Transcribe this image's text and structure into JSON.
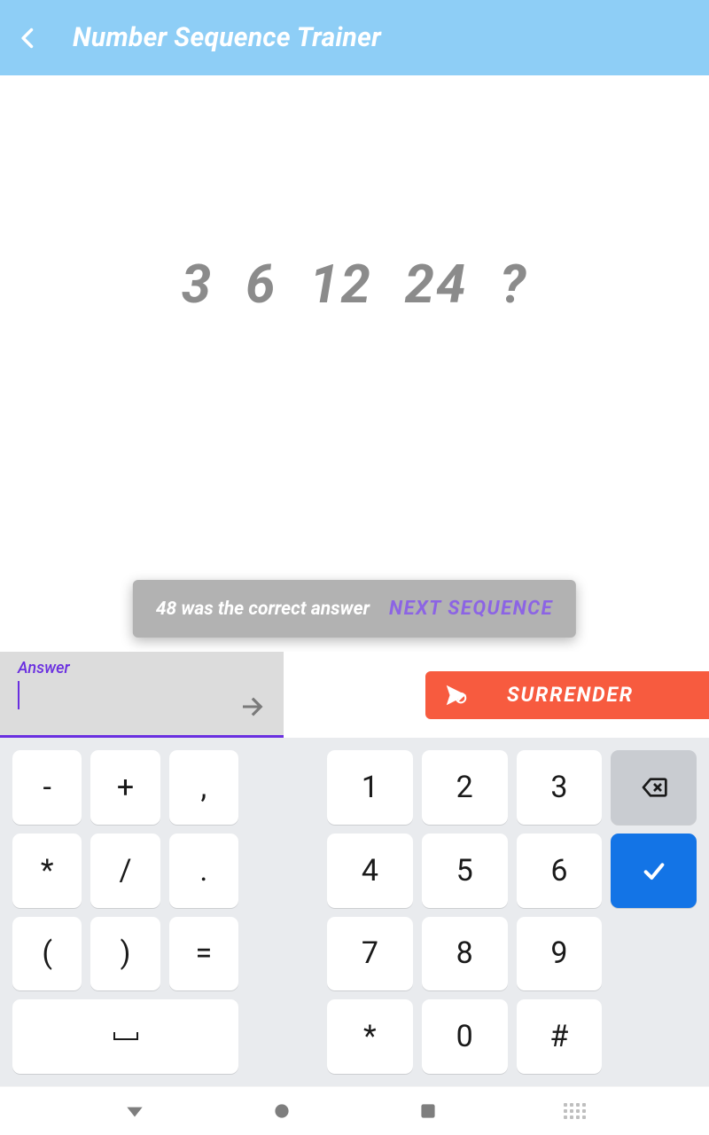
{
  "header": {
    "title": "Number Sequence Trainer"
  },
  "sequence_display": "3  6  12  24  ?",
  "snackbar": {
    "message": "48 was the correct answer",
    "action_label": "NEXT SEQUENCE"
  },
  "answer": {
    "label": "Answer",
    "value": ""
  },
  "surrender_label": "SURRENDER",
  "keyboard": {
    "left_rows": [
      [
        "-",
        "+",
        ","
      ],
      [
        "*",
        "/",
        "."
      ],
      [
        "(",
        ")",
        "="
      ]
    ],
    "left_space": "␣",
    "right_rows": [
      [
        "1",
        "2",
        "3"
      ],
      [
        "4",
        "5",
        "6"
      ],
      [
        "7",
        "8",
        "9"
      ],
      [
        "*",
        "0",
        "#"
      ]
    ]
  },
  "colors": {
    "header_bg": "#8ecef6",
    "accent": "#6a2fe0",
    "surrender": "#f75b3f",
    "enter": "#1374e6"
  }
}
